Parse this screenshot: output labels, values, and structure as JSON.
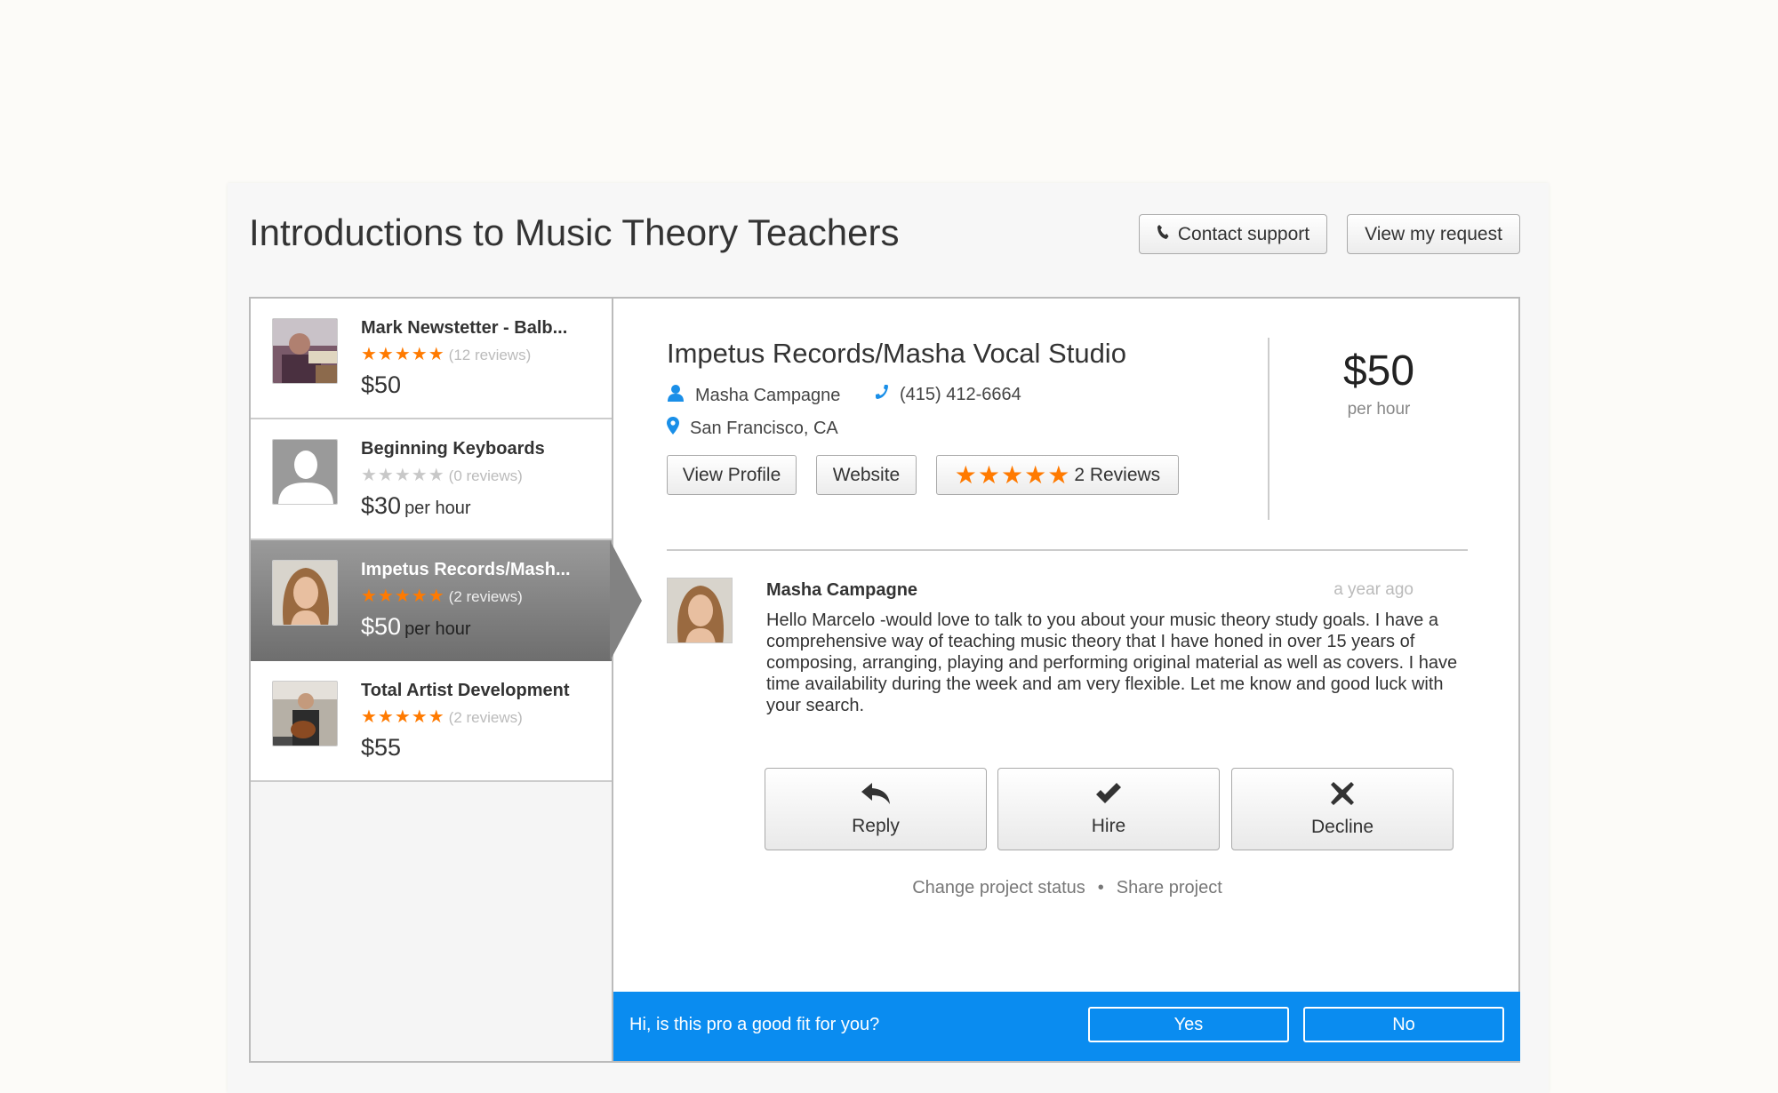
{
  "page": {
    "title": "Introductions to Music Theory Teachers",
    "contact_support": "Contact support",
    "view_request": "View my request"
  },
  "pros": [
    {
      "name": "Mark Newstetter - Balb...",
      "stars": "★★★★★",
      "rating": 5,
      "reviews": "(12 reviews)",
      "price": "$50",
      "unit": ""
    },
    {
      "name": "Beginning Keyboards",
      "stars": "★★★★★",
      "rating": 0,
      "reviews": "(0 reviews)",
      "price": "$30",
      "unit": "per hour"
    },
    {
      "name": "Impetus Records/Mash...",
      "stars": "★★★★★",
      "rating": 5,
      "reviews": "(2 reviews)",
      "price": "$50",
      "unit": "per hour"
    },
    {
      "name": "Total Artist Development",
      "stars": "★★★★★",
      "rating": 5,
      "reviews": "(2 reviews)",
      "price": "$55",
      "unit": ""
    }
  ],
  "detail": {
    "business_name": "Impetus Records/Masha Vocal Studio",
    "contact_name": "Masha Campagne",
    "phone": "(415) 412-6664",
    "location": "San Francisco, CA",
    "view_profile": "View Profile",
    "website": "Website",
    "reviews_stars": "★★★★★",
    "reviews_label": "2 Reviews",
    "price": "$50",
    "price_unit": "per hour"
  },
  "message": {
    "author": "Masha Campagne",
    "time": "a year ago",
    "body": "Hello Marcelo -would love to talk to you about your music theory study goals. I have a comprehensive way of teaching music theory that I have honed in over 15 years of composing, arranging, playing and performing original material as well as covers. I have time availability during the week and am very flexible. Let me know and good luck with your search."
  },
  "actions": {
    "reply": "Reply",
    "hire": "Hire",
    "decline": "Decline",
    "change_status": "Change project status",
    "separator": "•",
    "share": "Share project"
  },
  "fit": {
    "question": "Hi, is this pro a good fit for you?",
    "yes": "Yes",
    "no": "No"
  },
  "colors": {
    "accent_blue": "#0a8cf0",
    "star_orange": "#ff7a00",
    "star_grey": "#c8c8c8"
  }
}
